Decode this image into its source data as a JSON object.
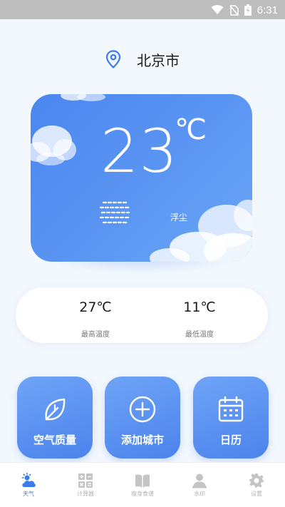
{
  "status_bar": {
    "time": "6:31"
  },
  "location": {
    "city": "北京市",
    "icon": "location-pin-icon"
  },
  "weather": {
    "temperature": "23",
    "unit": "℃",
    "condition": "浮尘",
    "condition_icon": "haze-icon"
  },
  "temps": {
    "high_value": "27℃",
    "high_label": "最高温度",
    "low_value": "11℃",
    "low_label": "最低温度"
  },
  "actions": [
    {
      "label": "空气质量",
      "icon": "leaf-icon"
    },
    {
      "label": "添加城市",
      "icon": "plus-circle-icon"
    },
    {
      "label": "日历",
      "icon": "calendar-icon"
    }
  ],
  "nav": [
    {
      "label": "天气",
      "icon": "weather-icon",
      "active": true
    },
    {
      "label": "计算器",
      "icon": "calculator-icon",
      "active": false
    },
    {
      "label": "瘦身食谱",
      "icon": "book-icon",
      "active": false
    },
    {
      "label": "水印",
      "icon": "person-icon",
      "active": false
    },
    {
      "label": "设置",
      "icon": "settings-icon",
      "active": false
    }
  ],
  "colors": {
    "accent": "#3a7bf0",
    "card_start": "#4b86f0",
    "card_end": "#6ba6f6",
    "background": "#f3f8fe"
  }
}
